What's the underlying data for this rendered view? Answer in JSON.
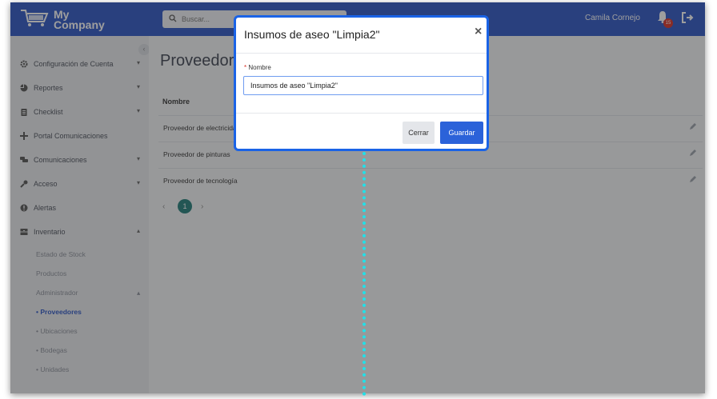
{
  "app": {
    "logo_line1": "My",
    "logo_line2": "Company"
  },
  "header": {
    "search_placeholder": "Buscar...",
    "user_name": "Camila Cornejo",
    "notification_count": "15"
  },
  "sidebar": {
    "items": [
      {
        "label": "Configuración de Cuenta",
        "icon": "gear-icon"
      },
      {
        "label": "Reportes",
        "icon": "pie-chart-icon"
      },
      {
        "label": "Checklist",
        "icon": "clipboard-icon"
      },
      {
        "label": "Portal Comunicaciones",
        "icon": "plus-icon"
      },
      {
        "label": "Comunicaciones",
        "icon": "chat-icon"
      },
      {
        "label": "Acceso",
        "icon": "key-icon"
      },
      {
        "label": "Alertas",
        "icon": "alert-icon"
      },
      {
        "label": "Inventario",
        "icon": "inventory-icon"
      }
    ],
    "inventory_sub": [
      "Estado de Stock",
      "Productos",
      "Administrador"
    ],
    "admin_sub": [
      "• Proveedores",
      "• Ubicaciones",
      "• Bodegas",
      "• Unidades"
    ]
  },
  "main": {
    "title": "Proveedores",
    "column_header": "Nombre",
    "rows": [
      "Proveedor de electricidad",
      "Proveedor de pinturas",
      "Proveedor de tecnología"
    ],
    "pagination": {
      "prev": "‹",
      "current": "1",
      "next": "›"
    }
  },
  "modal": {
    "title": "Insumos de aseo \"Limpia2\"",
    "close": "×",
    "field_required_mark": "*",
    "field_label": "Nombre",
    "field_value": "Insumos de aseo \"Limpia2\"",
    "cancel_label": "Cerrar",
    "save_label": "Guardar"
  }
}
